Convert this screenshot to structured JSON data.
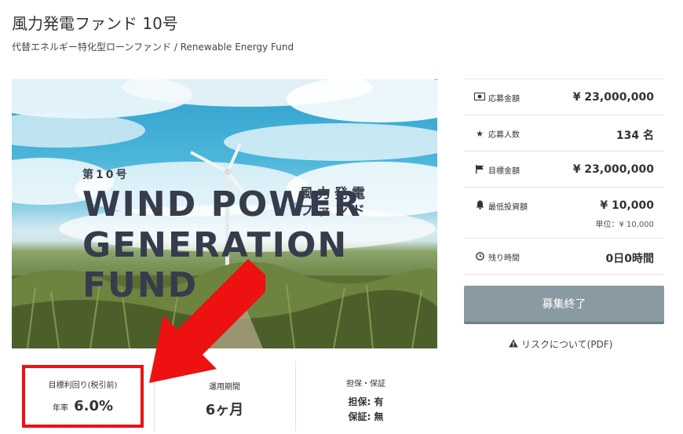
{
  "page": {
    "title": "風力発電ファンド 10号",
    "subtitle": "代替エネルギー特化型ローンファンド / Renewable Energy Fund"
  },
  "hero": {
    "number": "第10号",
    "line1": "WIND POWER",
    "line2": "GENERATION FUND",
    "jp_line1": "風力発電",
    "jp_line2": "ファンド"
  },
  "stats": [
    {
      "icon": "money-icon",
      "label": "応募金額",
      "value": "¥ 23,000,000"
    },
    {
      "icon": "star-icon",
      "label": "応募人数",
      "value": "134 名"
    },
    {
      "icon": "flag-icon",
      "label": "目標金額",
      "value": "¥ 23,000,000"
    },
    {
      "icon": "bell-icon",
      "label": "最低投資額",
      "value": "¥ 10,000",
      "sub": "単位：¥ 10,000"
    },
    {
      "icon": "clock-icon",
      "label": "残り時間",
      "value": "0日0時間"
    }
  ],
  "button": {
    "label": "募集終了"
  },
  "risk_link": {
    "label": "リスクについて(PDF)"
  },
  "bottom": {
    "yield": {
      "heading": "目標利回り(税引前)",
      "prefix": "年率",
      "value": "6.0%"
    },
    "period": {
      "heading": "運用期間",
      "value": "6ヶ月"
    },
    "collateral": {
      "heading": "担保・保証",
      "line1": "担保: 有",
      "line2": "保証: 無"
    }
  },
  "colors": {
    "button": "#8a9aa3",
    "annotation_red": "#ee1111"
  }
}
